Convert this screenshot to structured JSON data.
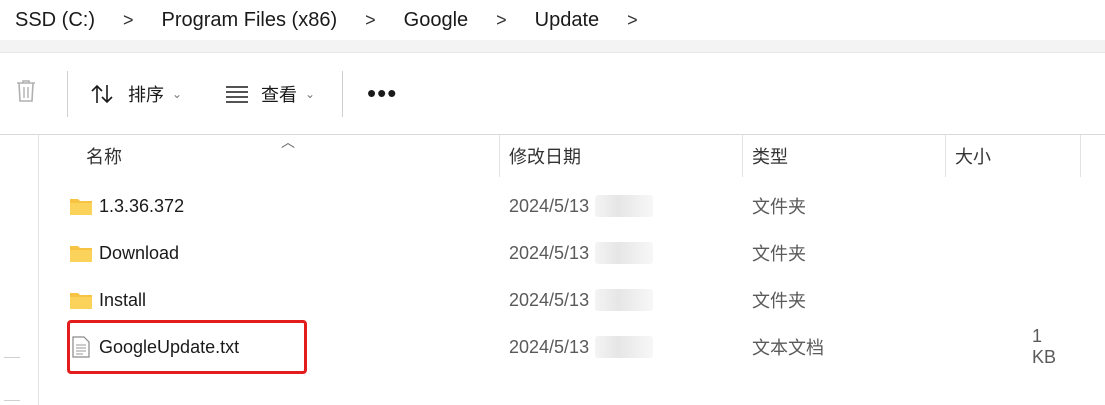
{
  "breadcrumb": {
    "items": [
      "SSD (C:)",
      "Program Files (x86)",
      "Google",
      "Update"
    ],
    "separator": ">"
  },
  "toolbar": {
    "delete_icon": "trash-icon",
    "sort_label": "排序",
    "view_label": "查看",
    "more_label": "•••"
  },
  "columns": {
    "name": "名称",
    "modified": "修改日期",
    "type": "类型",
    "size": "大小"
  },
  "files": [
    {
      "name": "1.3.36.372",
      "date": "2024/5/13",
      "type": "文件夹",
      "size": "",
      "icon": "folder-icon"
    },
    {
      "name": "Download",
      "date": "2024/5/13",
      "type": "文件夹",
      "size": "",
      "icon": "folder-icon"
    },
    {
      "name": "Install",
      "date": "2024/5/13",
      "type": "文件夹",
      "size": "",
      "icon": "folder-icon"
    },
    {
      "name": "GoogleUpdate.txt",
      "date": "2024/5/13",
      "type": "文本文档",
      "size": "1 KB",
      "icon": "text-file-icon"
    }
  ],
  "colors": {
    "highlight": "#e31c1c",
    "folder": "#f6c342"
  }
}
